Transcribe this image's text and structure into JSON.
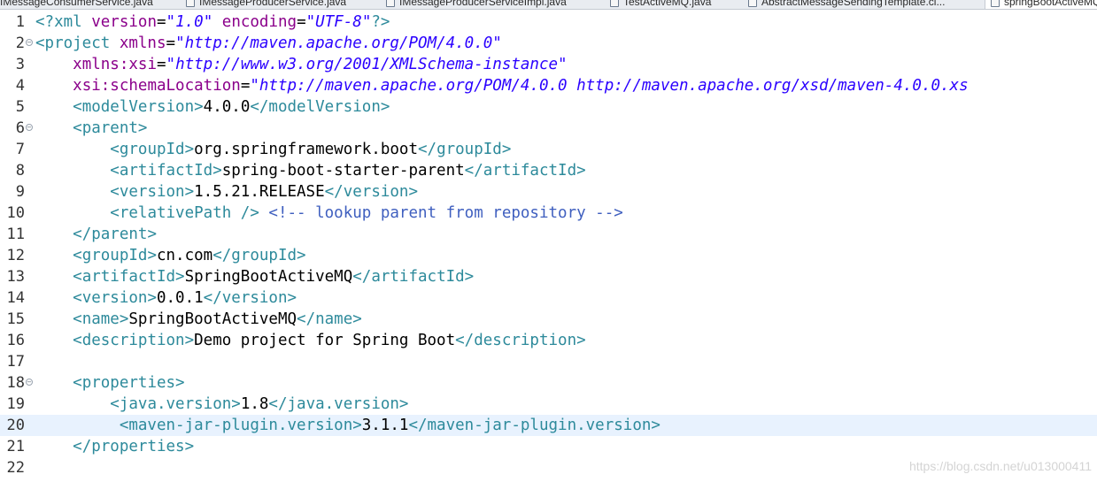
{
  "tabs": [
    {
      "label": "IMessageConsumerService.java"
    },
    {
      "label": "IMessageProducerService.java"
    },
    {
      "label": "IMessageProducerServiceImpl.java"
    },
    {
      "label": "TestActiveMQ.java"
    },
    {
      "label": "AbstractMessageSendingTemplate.cl..."
    },
    {
      "label": "springBootActiveMQ"
    }
  ],
  "colors": {
    "tag": "#2d8a9b",
    "attribute": "#8b008b",
    "string": "#2a00ff",
    "comment": "#3f5fbf",
    "current_line": "#e8f2fe"
  },
  "editor": {
    "current_line": 20,
    "folded_lines": [
      2,
      6,
      18
    ],
    "lines": [
      {
        "num": "1",
        "tokens": [
          [
            "t",
            "<?"
          ],
          [
            "t",
            "xml "
          ],
          [
            "a",
            "version"
          ],
          [
            "p",
            "="
          ],
          [
            "s",
            "\"1.0\""
          ],
          [
            "p",
            " "
          ],
          [
            "a",
            "encoding"
          ],
          [
            "p",
            "="
          ],
          [
            "s",
            "\"UTF-8\""
          ],
          [
            "t",
            "?>"
          ]
        ]
      },
      {
        "num": "2",
        "tokens": [
          [
            "t",
            "<project "
          ],
          [
            "a",
            "xmlns"
          ],
          [
            "p",
            "="
          ],
          [
            "s",
            "\"http://maven.apache.org/POM/4.0.0\""
          ]
        ]
      },
      {
        "num": "3",
        "tokens": [
          [
            "p",
            "    "
          ],
          [
            "a",
            "xmlns:xsi"
          ],
          [
            "p",
            "="
          ],
          [
            "s",
            "\"http://www.w3.org/2001/XMLSchema-instance\""
          ]
        ]
      },
      {
        "num": "4",
        "tokens": [
          [
            "p",
            "    "
          ],
          [
            "a",
            "xsi:schemaLocation"
          ],
          [
            "p",
            "="
          ],
          [
            "s",
            "\"http://maven.apache.org/POM/4.0.0 http://maven.apache.org/xsd/maven-4.0.0.xs"
          ]
        ]
      },
      {
        "num": "5",
        "tokens": [
          [
            "p",
            "    "
          ],
          [
            "t",
            "<modelVersion>"
          ],
          [
            "p",
            "4.0.0"
          ],
          [
            "t",
            "</modelVersion>"
          ]
        ]
      },
      {
        "num": "6",
        "tokens": [
          [
            "p",
            "    "
          ],
          [
            "t",
            "<parent>"
          ]
        ]
      },
      {
        "num": "7",
        "tokens": [
          [
            "p",
            "        "
          ],
          [
            "t",
            "<groupId>"
          ],
          [
            "p",
            "org.springframework.boot"
          ],
          [
            "t",
            "</groupId>"
          ]
        ]
      },
      {
        "num": "8",
        "tokens": [
          [
            "p",
            "        "
          ],
          [
            "t",
            "<artifactId>"
          ],
          [
            "p",
            "spring-boot-starter-parent"
          ],
          [
            "t",
            "</artifactId>"
          ]
        ]
      },
      {
        "num": "9",
        "tokens": [
          [
            "p",
            "        "
          ],
          [
            "t",
            "<version>"
          ],
          [
            "p",
            "1.5.21.RELEASE"
          ],
          [
            "t",
            "</version>"
          ]
        ]
      },
      {
        "num": "10",
        "tokens": [
          [
            "p",
            "        "
          ],
          [
            "t",
            "<relativePath />"
          ],
          [
            "p",
            " "
          ],
          [
            "c",
            "<!-- lookup parent from repository -->"
          ]
        ]
      },
      {
        "num": "11",
        "tokens": [
          [
            "p",
            "    "
          ],
          [
            "t",
            "</parent>"
          ]
        ]
      },
      {
        "num": "12",
        "tokens": [
          [
            "p",
            "    "
          ],
          [
            "t",
            "<groupId>"
          ],
          [
            "p",
            "cn.com"
          ],
          [
            "t",
            "</groupId>"
          ]
        ]
      },
      {
        "num": "13",
        "tokens": [
          [
            "p",
            "    "
          ],
          [
            "t",
            "<artifactId>"
          ],
          [
            "p",
            "SpringBootActiveMQ"
          ],
          [
            "t",
            "</artifactId>"
          ]
        ]
      },
      {
        "num": "14",
        "tokens": [
          [
            "p",
            "    "
          ],
          [
            "t",
            "<version>"
          ],
          [
            "p",
            "0.0.1"
          ],
          [
            "t",
            "</version>"
          ]
        ]
      },
      {
        "num": "15",
        "tokens": [
          [
            "p",
            "    "
          ],
          [
            "t",
            "<name>"
          ],
          [
            "p",
            "SpringBootActiveMQ"
          ],
          [
            "t",
            "</name>"
          ]
        ]
      },
      {
        "num": "16",
        "tokens": [
          [
            "p",
            "    "
          ],
          [
            "t",
            "<description>"
          ],
          [
            "p",
            "Demo project for Spring Boot"
          ],
          [
            "t",
            "</description>"
          ]
        ]
      },
      {
        "num": "17",
        "tokens": []
      },
      {
        "num": "18",
        "tokens": [
          [
            "p",
            "    "
          ],
          [
            "t",
            "<properties>"
          ]
        ]
      },
      {
        "num": "19",
        "tokens": [
          [
            "p",
            "        "
          ],
          [
            "t",
            "<java.version>"
          ],
          [
            "p",
            "1.8"
          ],
          [
            "t",
            "</java.version>"
          ]
        ]
      },
      {
        "num": "20",
        "tokens": [
          [
            "p",
            "         "
          ],
          [
            "t",
            "<maven-jar-plugin.version>"
          ],
          [
            "p",
            "3.1.1"
          ],
          [
            "t",
            "</maven-jar-plugin.version>"
          ]
        ]
      },
      {
        "num": "21",
        "tokens": [
          [
            "p",
            "    "
          ],
          [
            "t",
            "</properties>"
          ]
        ]
      },
      {
        "num": "22",
        "tokens": []
      }
    ]
  },
  "watermark": "https://blog.csdn.net/u013000411"
}
